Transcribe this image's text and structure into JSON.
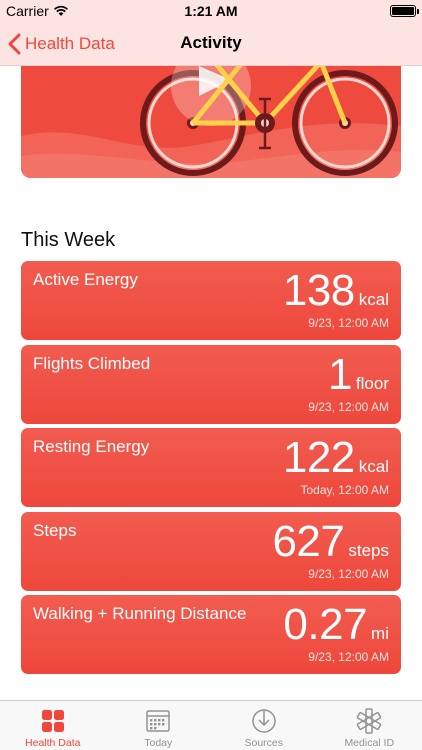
{
  "status_bar": {
    "carrier": "Carrier",
    "time": "1:21 AM"
  },
  "nav": {
    "back_label": "Health Data",
    "title": "Activity"
  },
  "section_title": "This Week",
  "cards": [
    {
      "label": "Active Energy",
      "value": "138",
      "unit": "kcal",
      "date": "9/23, 12:00 AM"
    },
    {
      "label": "Flights Climbed",
      "value": "1",
      "unit": "floor",
      "date": "9/23, 12:00 AM"
    },
    {
      "label": "Resting Energy",
      "value": "122",
      "unit": "kcal",
      "date": "Today, 12:00 AM"
    },
    {
      "label": "Steps",
      "value": "627",
      "unit": "steps",
      "date": "9/23, 12:00 AM"
    },
    {
      "label": "Walking + Running Distance",
      "value": "0.27",
      "unit": "mi",
      "date": "9/23, 12:00 AM"
    }
  ],
  "tabs": [
    {
      "label": "Health Data",
      "icon": "grid-icon",
      "active": true
    },
    {
      "label": "Today",
      "icon": "calendar-icon",
      "active": false
    },
    {
      "label": "Sources",
      "icon": "download-icon",
      "active": false
    },
    {
      "label": "Medical ID",
      "icon": "medical-star-icon",
      "active": false
    }
  ],
  "colors": {
    "accent": "#f0473c",
    "card": "#ef4d41",
    "nav_bg": "#fbe4e1",
    "tab_inactive": "#929292"
  }
}
